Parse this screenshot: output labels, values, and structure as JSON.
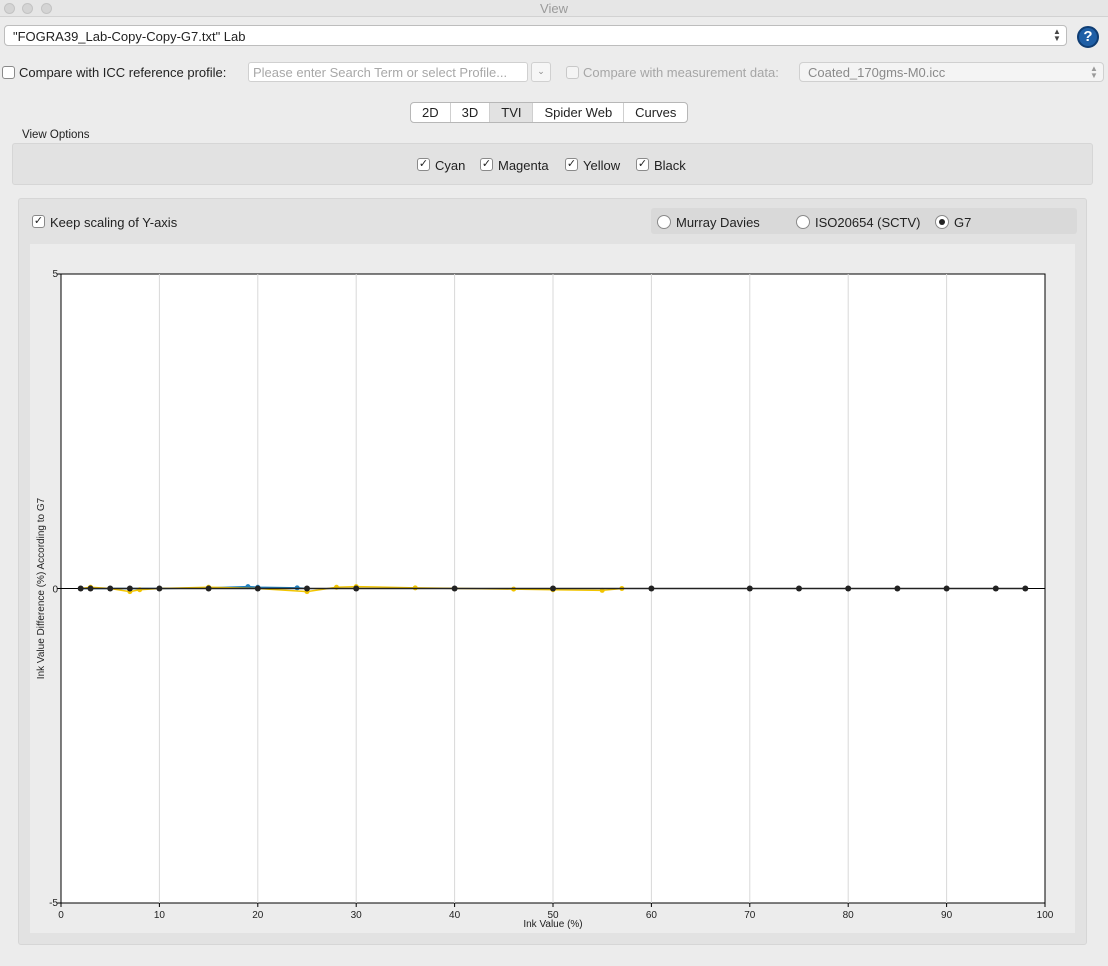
{
  "window": {
    "title": "View"
  },
  "profile_select": {
    "value": "\"FOGRA39_Lab-Copy-Copy-G7.txt\" Lab"
  },
  "help_button": {
    "label": "?"
  },
  "compare_icc": {
    "label": "Compare with ICC reference profile:",
    "checked": false,
    "placeholder": "Please enter Search Term or select Profile..."
  },
  "compare_measurement": {
    "label": "Compare with measurement data:",
    "checked": false,
    "value": "Coated_170gms-M0.icc"
  },
  "tabs": [
    {
      "label": "2D",
      "active": false
    },
    {
      "label": "3D",
      "active": false
    },
    {
      "label": "TVI",
      "active": true
    },
    {
      "label": "Spider Web",
      "active": false
    },
    {
      "label": "Curves",
      "active": false
    }
  ],
  "view_options": {
    "label": "View Options",
    "channels": [
      {
        "label": "Cyan",
        "checked": true
      },
      {
        "label": "Magenta",
        "checked": true
      },
      {
        "label": "Yellow",
        "checked": true
      },
      {
        "label": "Black",
        "checked": true
      }
    ]
  },
  "keep_scaling": {
    "label": "Keep scaling of Y-axis",
    "checked": true
  },
  "tvi_method": {
    "options": [
      "Murray Davies",
      "ISO20654 (SCTV)",
      "G7"
    ],
    "selected": "G7"
  },
  "colors": {
    "cyan": "#1f7fbf",
    "magenta": "#c8408a",
    "yellow": "#f2c500",
    "black": "#222222",
    "grid": "#d8d8d8"
  },
  "chart_data": {
    "type": "line",
    "xlabel": "Ink Value (%)",
    "ylabel": "Ink Value Difference (%) According to G7",
    "xlim": [
      0,
      100
    ],
    "ylim": [
      -5,
      5
    ],
    "xticks": [
      0,
      10,
      20,
      30,
      40,
      50,
      60,
      70,
      80,
      90,
      100
    ],
    "yticks": [
      -5,
      0,
      5
    ],
    "grid": "vertical",
    "series": [
      {
        "name": "Cyan",
        "color": "cyan",
        "x": [
          2,
          3,
          5,
          7,
          10,
          15,
          19,
          20,
          24,
          25
        ],
        "y": [
          0,
          0,
          0,
          0,
          0,
          0.01,
          0.03,
          0.02,
          0.01,
          0
        ]
      },
      {
        "name": "Yellow",
        "color": "yellow",
        "x": [
          2,
          3,
          5,
          7,
          8,
          10,
          15,
          20,
          25,
          28,
          30,
          36,
          46,
          50,
          55,
          57
        ],
        "y": [
          0,
          0.02,
          0,
          -0.05,
          -0.02,
          0,
          0.02,
          0,
          -0.05,
          0.02,
          0.03,
          0.01,
          -0.01,
          -0.02,
          -0.03,
          0
        ]
      },
      {
        "name": "Black",
        "color": "black",
        "x": [
          2,
          3,
          5,
          7,
          10,
          15,
          20,
          25,
          30,
          40,
          50,
          60,
          70,
          75,
          80,
          85,
          90,
          95,
          98
        ],
        "y": [
          0,
          0,
          0,
          0,
          0,
          0,
          0,
          0,
          0,
          0,
          0,
          0,
          0,
          0,
          0,
          0,
          0,
          0,
          0
        ]
      }
    ]
  }
}
